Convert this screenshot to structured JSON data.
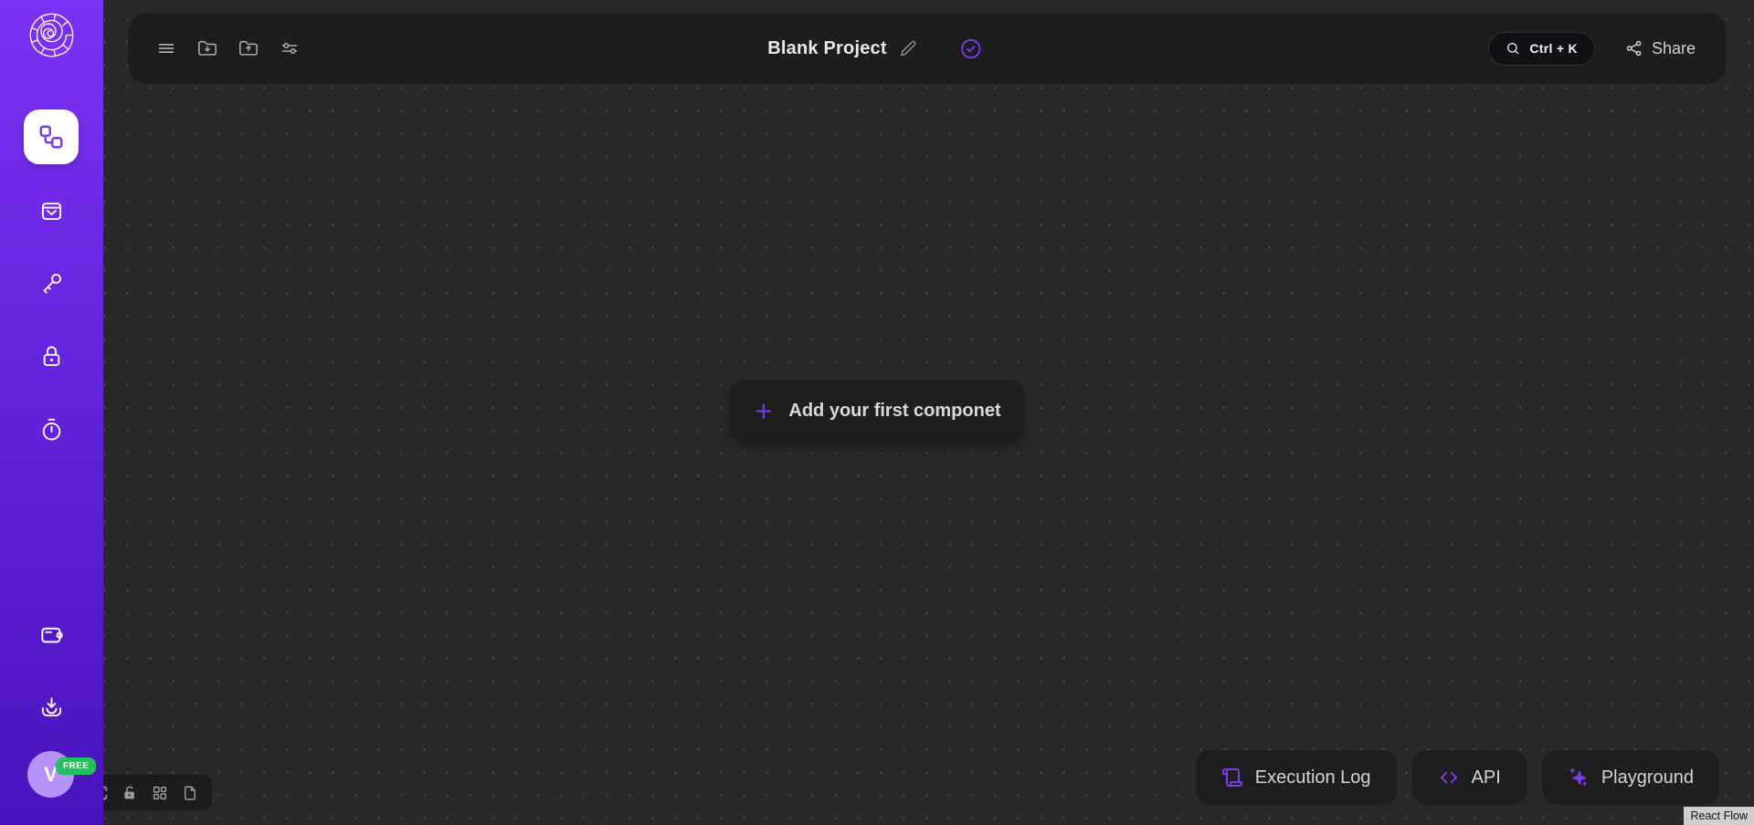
{
  "colors": {
    "accent": "#7c3aed",
    "sidebar_gradient_top": "#7d31f3",
    "sidebar_gradient_bottom": "#4a13bd",
    "canvas_bg": "#292929",
    "panel_bg": "#1d1d1d",
    "badge_green": "#25c05f",
    "avatar_bg": "#b493f9"
  },
  "sidebar": {
    "logo_icon": "nautilus-logo",
    "nav_top": [
      {
        "icon": "workflow-icon",
        "active": true
      },
      {
        "icon": "inbox-icon",
        "active": false
      },
      {
        "icon": "key-icon",
        "active": false
      },
      {
        "icon": "lock-icon",
        "active": false
      },
      {
        "icon": "timer-icon",
        "active": false
      }
    ],
    "nav_bottom": [
      {
        "icon": "wallet-icon"
      },
      {
        "icon": "import-icon"
      }
    ],
    "profile": {
      "initial": "V",
      "badge": "FREE"
    }
  },
  "toolbar": {
    "icons_left": [
      "menu-icon",
      "folder-import-icon",
      "folder-export-icon",
      "settings-sliders-icon"
    ],
    "title": "Blank Project",
    "edit_icon": "pencil-icon",
    "status_icon": "check-circle-icon",
    "search_shortcut": "Ctrl + K",
    "share_label": "Share"
  },
  "canvas": {
    "empty_state_label": "Add your first componet",
    "zoom_controls": [
      "zoom-in-icon",
      "zoom-out-icon",
      "fit-view-icon",
      "lock-icon",
      "grid-icon",
      "file-icon"
    ],
    "attribution": "React Flow"
  },
  "bottom_actions": [
    {
      "icon": "scroll-icon",
      "label": "Execution Log"
    },
    {
      "icon": "code-icon",
      "label": "API"
    },
    {
      "icon": "sparkles-icon",
      "label": "Playground"
    }
  ]
}
